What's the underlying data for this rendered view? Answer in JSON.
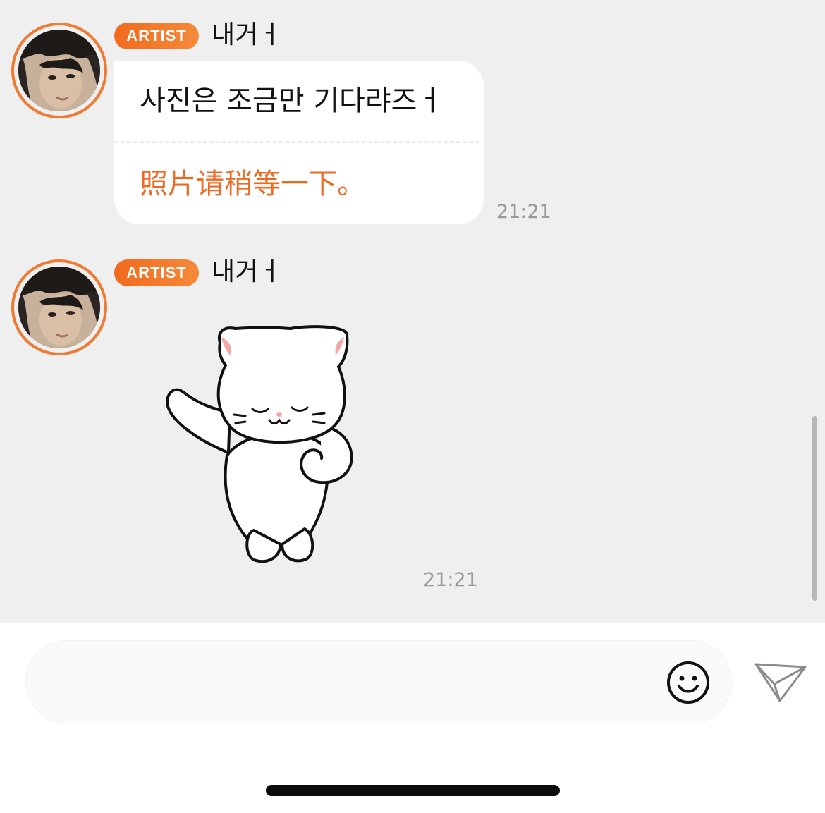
{
  "colors": {
    "chat_background": "#efefef",
    "accent": "#f07a32",
    "badge_gradient_start": "#f26a1e",
    "translation_text": "#ee6a22",
    "timestamp_text": "#9a9a9a"
  },
  "messages": [
    {
      "badge": "ARTIST",
      "sender": "내거ㅓ",
      "avatar_icon": "artist-profile-photo",
      "original_text": "사진은 조금만 기다랴즈ㅓ",
      "translated_text": "照片请稍等一下。",
      "time": "21:21"
    },
    {
      "badge": "ARTIST",
      "sender": "내거ㅓ",
      "avatar_icon": "artist-profile-photo",
      "sticker_icon": "white-cat-waving-sticker",
      "time": "21:21"
    }
  ],
  "composer": {
    "placeholder": "",
    "emoji_icon": "smiley-face-icon",
    "send_icon": "paper-plane-icon"
  }
}
